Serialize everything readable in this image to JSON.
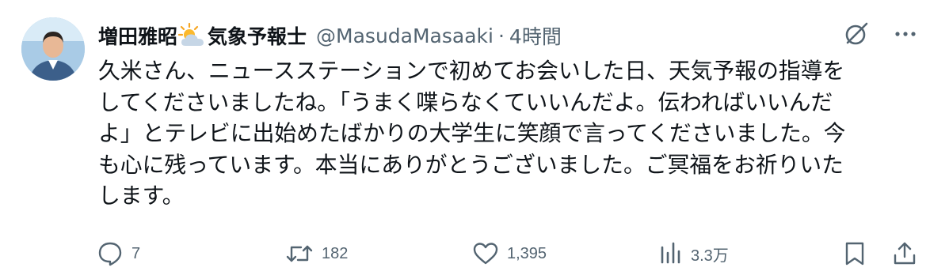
{
  "post": {
    "author_name": "増田雅昭",
    "author_name_suffix": "気象予報士",
    "handle": "@MasudaMasaaki",
    "separator": "·",
    "time": "4時間",
    "text": "久米さん、ニュースステーションで初めてお会いした日、天気予報の指導を\nしてくださいましたね。「うまく喋らなくていいんだよ。伝わればいいんだ\nよ」とテレビに出始めたばかりの大学生に笑顔で言ってくださいました。今\nも心に残っています。本当にありがとうございました。ご冥福をお祈りいた\nします。"
  },
  "actions": {
    "replies": "7",
    "reposts": "182",
    "likes": "1,395",
    "views": "3.3万"
  },
  "icons": {
    "name_emoji": "sun-behind-cloud-icon",
    "grok": "grok-slash-icon",
    "more": "more-dots-icon",
    "reply": "reply-bubble-icon",
    "repost": "repost-icon",
    "like": "heart-icon",
    "views": "views-bar-chart-icon",
    "bookmark": "bookmark-icon",
    "share": "share-icon"
  },
  "colors": {
    "text": "#0f1419",
    "secondary": "#536471"
  }
}
